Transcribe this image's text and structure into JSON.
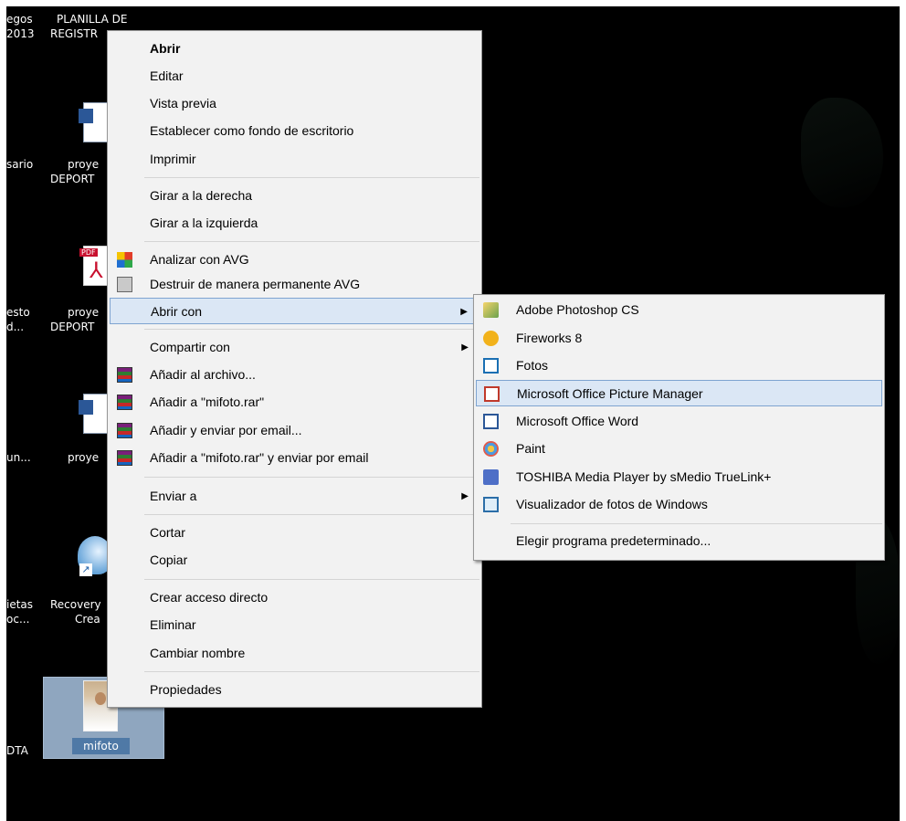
{
  "desktop": {
    "labels": {
      "col0_row0a": "egos",
      "col0_row0b": "2013",
      "col1_row0a": "PLANILLA DE",
      "col1_row0b": "REGISTR",
      "col0_row1": "sario",
      "col1_row1a": "proye",
      "col1_row1b": "DEPORT",
      "col0_row2a": "esto",
      "col0_row2b": "d...",
      "col1_row2a": "proye",
      "col1_row2b": "DEPORT",
      "col0_row3": "un...",
      "col1_row3": "proye",
      "col0_row4a": "ietas",
      "col0_row4b": "oc...",
      "col1_row4a": "Recovery",
      "col1_row4b": "Crea",
      "col0_row5": "DTA",
      "selected": "mifoto"
    }
  },
  "context_menu": {
    "items": [
      {
        "label": "Abrir"
      },
      {
        "label": "Editar"
      },
      {
        "label": "Vista previa"
      },
      {
        "label": "Establecer como fondo de escritorio"
      },
      {
        "label": "Imprimir"
      },
      {
        "label": "Girar a la derecha"
      },
      {
        "label": "Girar a la izquierda"
      },
      {
        "label": "Analizar con AVG"
      },
      {
        "label": "Destruir de manera permanente AVG"
      },
      {
        "label": "Abrir con"
      },
      {
        "label": "Compartir con"
      },
      {
        "label": "Añadir al archivo..."
      },
      {
        "label": "Añadir a \"mifoto.rar\""
      },
      {
        "label": "Añadir y enviar por email..."
      },
      {
        "label": "Añadir a \"mifoto.rar\" y enviar por email"
      },
      {
        "label": "Enviar a"
      },
      {
        "label": "Cortar"
      },
      {
        "label": "Copiar"
      },
      {
        "label": "Crear acceso directo"
      },
      {
        "label": "Eliminar"
      },
      {
        "label": "Cambiar nombre"
      },
      {
        "label": "Propiedades"
      }
    ],
    "submenu_arrow": "▶"
  },
  "open_with_menu": {
    "items": [
      {
        "label": "Adobe Photoshop CS"
      },
      {
        "label": "Fireworks 8"
      },
      {
        "label": "Fotos"
      },
      {
        "label": "Microsoft Office Picture Manager"
      },
      {
        "label": "Microsoft Office Word"
      },
      {
        "label": "Paint"
      },
      {
        "label": "TOSHIBA Media Player by sMedio TrueLink+"
      },
      {
        "label": "Visualizador de fotos de Windows"
      },
      {
        "label": "Elegir programa predeterminado..."
      }
    ]
  },
  "colors": {
    "highlight": "#dbe7f5",
    "highlight_border": "#7ea4d0",
    "menu_bg": "#f2f2f2",
    "desktop_bg": "#000000"
  }
}
